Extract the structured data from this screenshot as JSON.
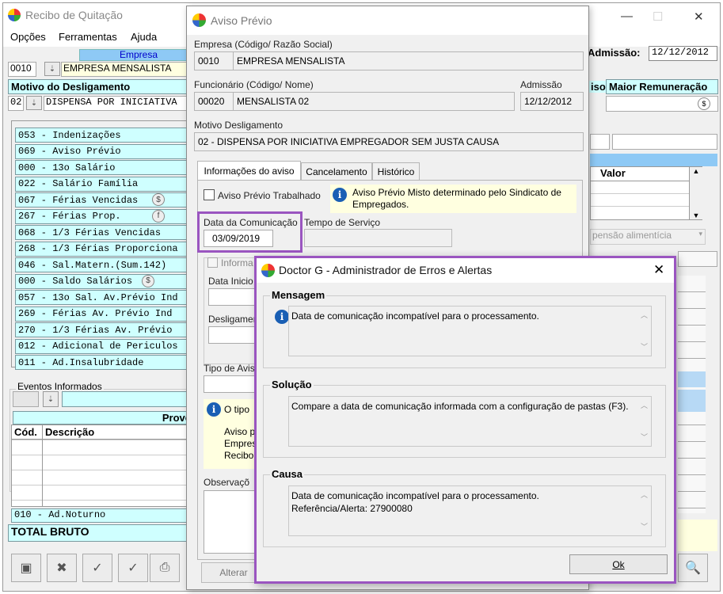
{
  "main_window": {
    "title": "Recibo de Quitação",
    "menu": [
      "Opções",
      "Ferramentas",
      "Ajuda"
    ],
    "empresa_header": "Empresa",
    "empresa_code": "0010",
    "empresa_name": "EMPRESA MENSALISTA",
    "admissao_label": "Admissão:",
    "admissao_value": "12/12/2012",
    "motivo_header": "Motivo do Desligamento",
    "motivo_code": "02",
    "motivo_text": "DISPENSA POR INICIATIVA",
    "aviso_header_fragment": "iso",
    "maior_remuneracao": "Maior Remuneração",
    "valor_header": "Valor",
    "pensao_text": "pensão alimentícia",
    "events": [
      "053 - Indenizações",
      "069 - Aviso Prévio",
      "000 - 13o Salário",
      "022 - Salário Família",
      "067 - Férias Vencidas",
      "267 - Férias Prop.",
      "068 - 1/3 Férias Vencidas",
      "268 - 1/3 Férias Proporciona",
      "046 - Sal.Matern.(Sum.142)",
      "000 - Saldo Salários",
      "057 - 13o Sal. Av.Prévio Ind",
      "269 -  Férias  Av. Prévio Ind",
      "270 - 1/3 Férias Av. Prévio",
      "012 - Adicional de Periculos",
      "011 - Ad.Insalubridade"
    ],
    "eventos_informados": "Eventos Informados",
    "proventos_fragment": "Prove",
    "col_cod": "Cód.",
    "col_descricao": "Descrição",
    "ad_noturno": "010 - Ad.Noturno",
    "total_bruto": "TOTAL BRUTO"
  },
  "aviso_dialog": {
    "title": "Aviso Prévio",
    "empresa_label": "Empresa (Código/ Razão Social)",
    "empresa_code": "0010",
    "empresa_name": "EMPRESA MENSALISTA",
    "funcionario_label": "Funcionário (Código/ Nome)",
    "funcionario_code": "00020",
    "funcionario_name": "MENSALISTA 02",
    "admissao_label": "Admissão",
    "admissao_value": "12/12/2012",
    "motivo_label": "Motivo Desligamento",
    "motivo_value": "02 - DISPENSA POR INICIATIVA EMPREGADOR SEM JUSTA CAUSA",
    "tabs": [
      "Informações do aviso",
      "Cancelamento",
      "Histórico"
    ],
    "aviso_trabalhado_label": "Aviso Prévio Trabalhado",
    "aviso_misto_note": "Aviso Prévio Misto determinado pelo Sindicato de Empregados.",
    "data_comunicacao_label": "Data da Comunicação",
    "data_comunicacao_value": "03/09/2019",
    "tempo_servico_label": "Tempo de Serviço",
    "informa_fragment": "Informa",
    "data_inicio_fragment": "Data Inicio",
    "desligamento_fragment": "Desligamen",
    "tipo_aviso_fragment": "Tipo de Avis",
    "o_tipo_fragment": "O tipo",
    "aviso_p_fragment": "Aviso p",
    "empres_fragment": "Empres",
    "recibo_fragment": "Recibo",
    "observacoes_fragment": "Observaçõ",
    "alterar_button": "Alterar"
  },
  "doctor_dialog": {
    "title": "Doctor G - Administrador de Erros e Alertas",
    "mensagem_title": "Mensagem",
    "mensagem_text": "Data de comunicação incompatível para o processamento.",
    "solucao_title": "Solução",
    "solucao_text": "Compare a data de comunicação informada com a configuração de pastas (F3).",
    "causa_title": "Causa",
    "causa_line1": "Data de comunicação incompatível para o processamento.",
    "causa_line2": "Referência/Alerta: 27900080",
    "ok_button": "Ok"
  },
  "colors": {
    "cyan": "#cfffff",
    "highlight_purple": "#9a55c0",
    "info_blue": "#1a5fb4",
    "note_yellow": "#ffffe0"
  }
}
